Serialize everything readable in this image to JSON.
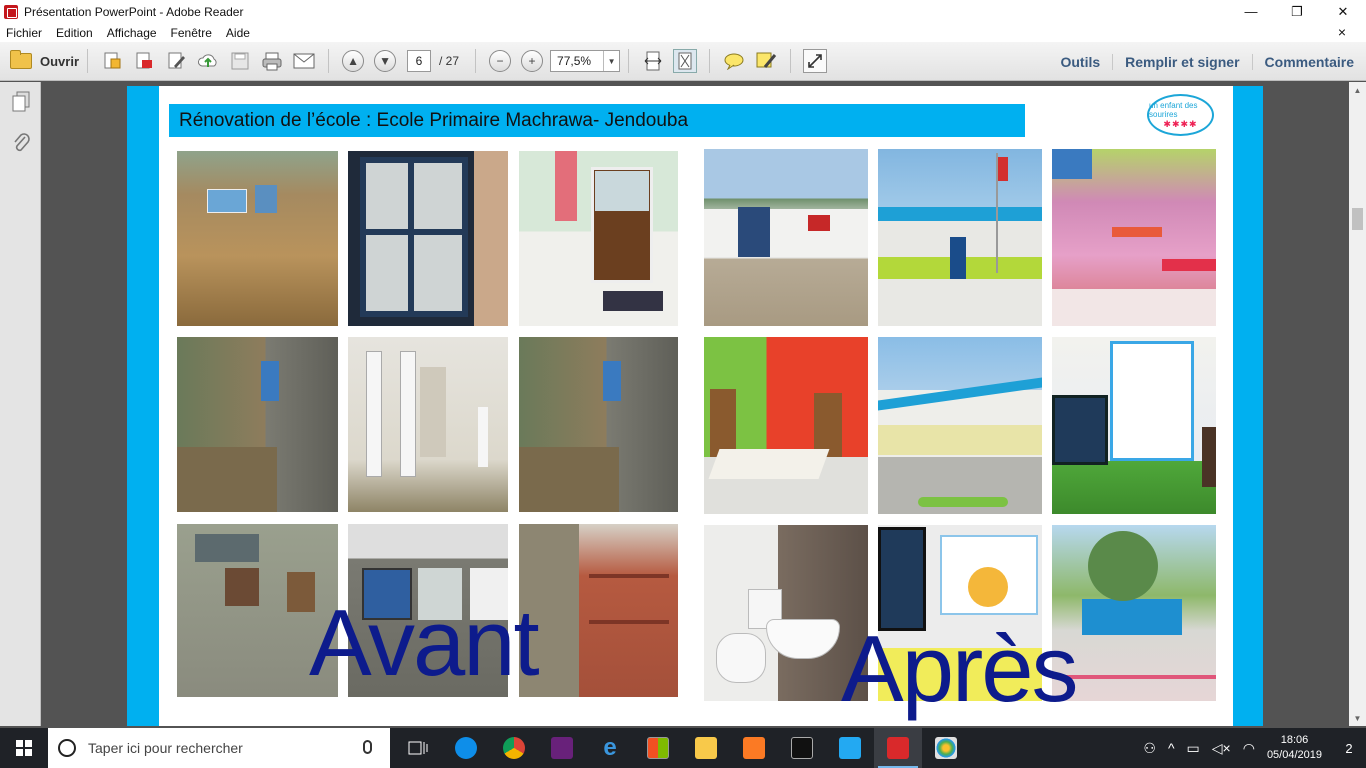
{
  "window": {
    "title": "Présentation PowerPoint - Adobe Reader",
    "controls": {
      "minimize": "—",
      "restore": "❐",
      "close": "✕"
    }
  },
  "menu": {
    "items": [
      "Fichier",
      "Edition",
      "Affichage",
      "Fenêtre",
      "Aide"
    ],
    "close_glyph": "×"
  },
  "toolbar": {
    "open_label": "Ouvrir",
    "page_current": "6",
    "page_total": "/ 27",
    "zoom_value": "77,5%",
    "right_links": [
      "Outils",
      "Remplir et signer",
      "Commentaire"
    ]
  },
  "slide": {
    "banner_title": "Rénovation de l’école : Ecole Primaire Machrawa- Jendouba",
    "logo_text": "un enfant des sourires",
    "caption_before": "Avant",
    "caption_after": "Après"
  },
  "taskbar": {
    "search_placeholder": "Taper ici pour rechercher",
    "time": "18:06",
    "date": "05/04/2019",
    "notifications": "2"
  },
  "colors": {
    "slide_border": "#00b0f0",
    "caption": "#0d1b8c",
    "taskbar": "#1f2227"
  }
}
